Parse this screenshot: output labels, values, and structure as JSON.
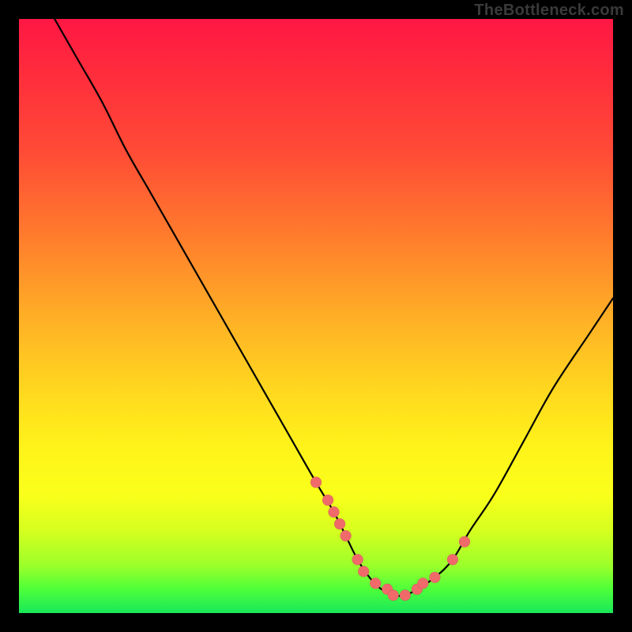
{
  "attribution": "TheBottleneck.com",
  "colors": {
    "page_bg": "#000000",
    "gradient_stops": [
      "#ff1744",
      "#ff2a3d",
      "#ff4a36",
      "#ff7a2d",
      "#ffae26",
      "#ffd61f",
      "#fff31a",
      "#faff1a",
      "#d7ff1f",
      "#9cff2a",
      "#4eff3a",
      "#18e85a"
    ],
    "curve_stroke": "#000000",
    "dot_fill": "#f06a6a"
  },
  "chart_data": {
    "type": "line",
    "title": "",
    "xlabel": "",
    "ylabel": "",
    "xlim": [
      0,
      100
    ],
    "ylim": [
      0,
      100
    ],
    "series": [
      {
        "name": "bottleneck-curve",
        "x": [
          6,
          10,
          14,
          18,
          22,
          26,
          30,
          34,
          38,
          42,
          46,
          50,
          53,
          55,
          57,
          59,
          61,
          63,
          65,
          67,
          70,
          73,
          76,
          80,
          85,
          90,
          96,
          100
        ],
        "y": [
          100,
          93,
          86,
          78,
          71,
          64,
          57,
          50,
          43,
          36,
          29,
          22,
          17,
          13,
          9,
          6,
          4,
          3,
          3,
          4,
          6,
          9,
          14,
          20,
          29,
          38,
          47,
          53
        ]
      }
    ],
    "data_points": {
      "name": "highlighted-samples",
      "x": [
        50,
        52,
        53,
        54,
        55,
        57,
        58,
        60,
        62,
        63,
        65,
        67,
        68,
        70,
        73,
        75
      ],
      "y": [
        22,
        19,
        17,
        15,
        13,
        9,
        7,
        5,
        4,
        3,
        3,
        4,
        5,
        6,
        9,
        12
      ],
      "radius": 7
    }
  }
}
